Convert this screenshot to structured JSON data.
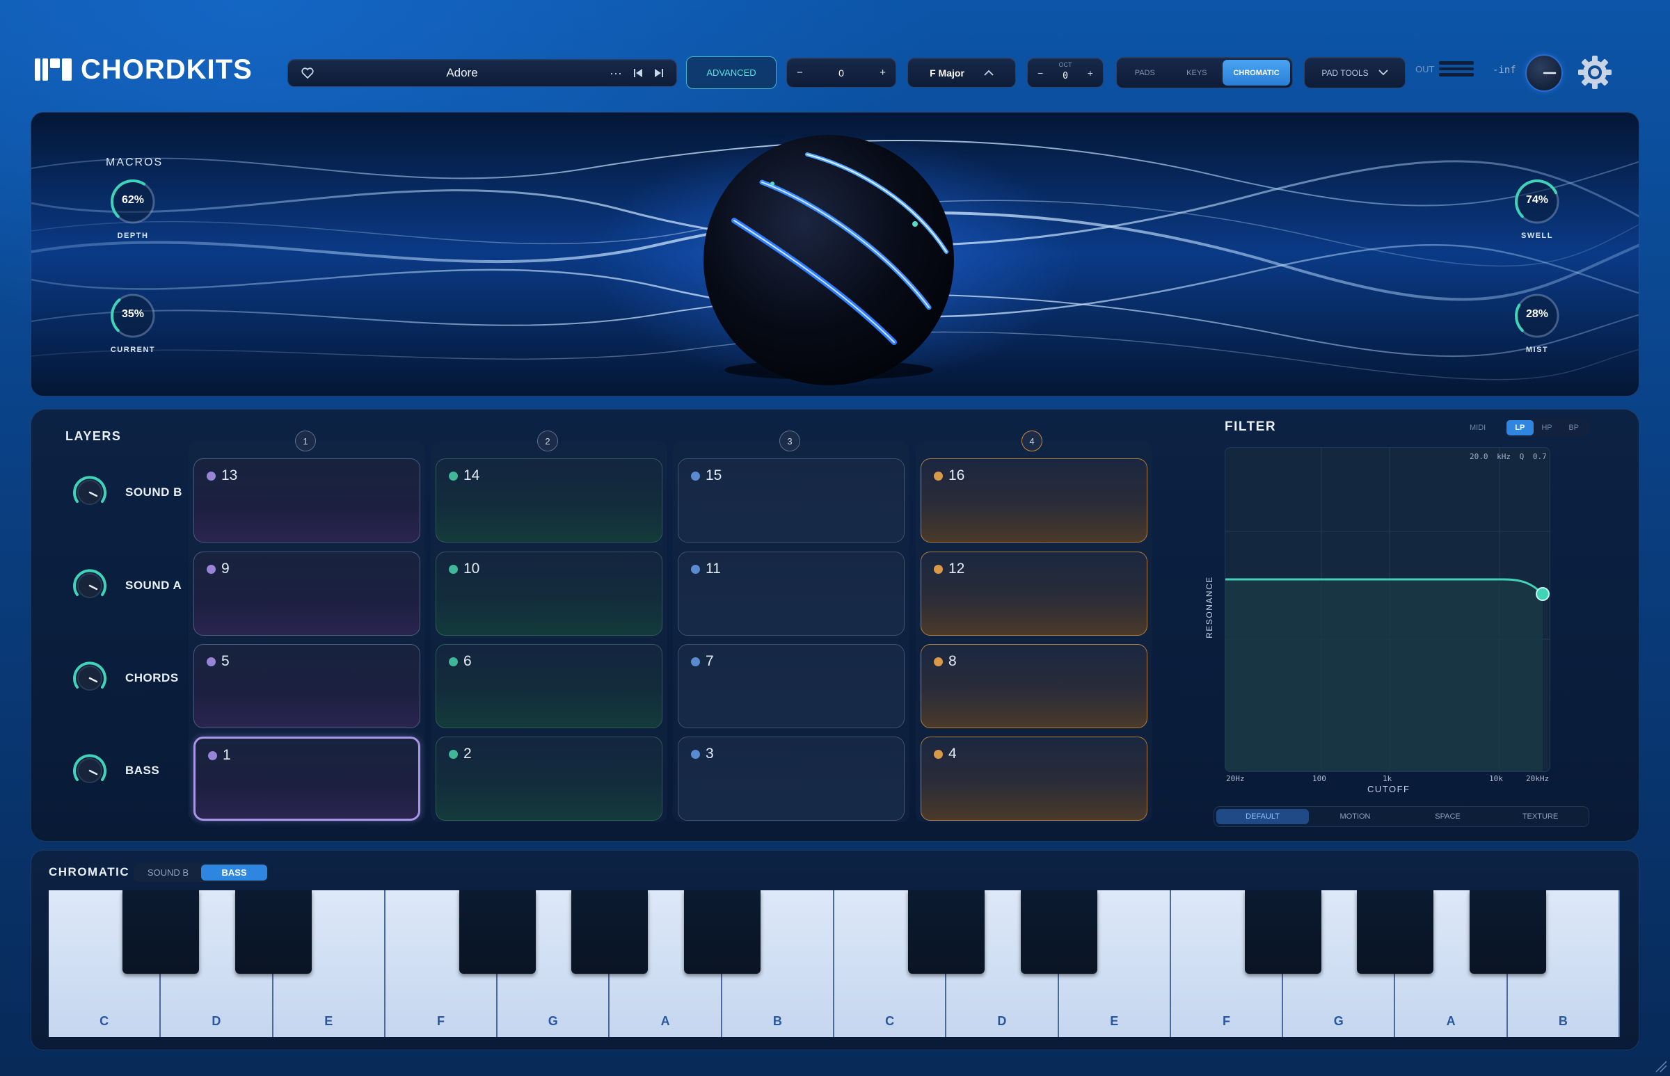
{
  "app": {
    "name": "CHORDKITS"
  },
  "header": {
    "preset_name": "Adore",
    "advanced_label": "ADVANCED",
    "transpose_value": "0",
    "transpose_minus": "−",
    "transpose_plus": "+",
    "key_label": "F Major",
    "oct_label": "OCT",
    "oct_value": "0",
    "modes": [
      {
        "label": "PADS"
      },
      {
        "label": "KEYS"
      },
      {
        "label": "CHROMATIC"
      }
    ],
    "active_mode": "CHROMATIC",
    "pad_tools_label": "PAD TOOLS",
    "out_label": "OUT",
    "out_level": "-inf"
  },
  "macros": {
    "title": "MACROS",
    "items": [
      {
        "name": "DEPTH",
        "value": "62%",
        "level": 0.62
      },
      {
        "name": "CURRENT",
        "value": "35%",
        "level": 0.35
      },
      {
        "name": "SWELL",
        "value": "74%",
        "level": 0.74
      },
      {
        "name": "MIST",
        "value": "28%",
        "level": 0.28
      }
    ]
  },
  "layers": {
    "title": "LAYERS",
    "rows": [
      {
        "label": "SOUND B",
        "pads": [
          "13",
          "14",
          "15",
          "16"
        ]
      },
      {
        "label": "SOUND A",
        "pads": [
          "9",
          "10",
          "11",
          "12"
        ]
      },
      {
        "label": "CHORDS",
        "pads": [
          "5",
          "6",
          "7",
          "8"
        ]
      },
      {
        "label": "BASS",
        "pads": [
          "1",
          "2",
          "3",
          "4"
        ]
      }
    ],
    "columns": [
      "1",
      "2",
      "3",
      "4"
    ],
    "selected_pad": "1"
  },
  "filter": {
    "title": "FILTER",
    "midi_label": "MIDI",
    "types": [
      "LP",
      "HP",
      "BP"
    ],
    "active_type": "LP",
    "freq_readout": "20.0 kHz",
    "q_readout": "Q 0.7",
    "y_label": "RESONANCE",
    "x_label": "CUTOFF",
    "x_ticks": [
      "20Hz",
      "100",
      "1k",
      "10k",
      "20kHz"
    ],
    "tabs": [
      "DEFAULT",
      "MOTION",
      "SPACE",
      "TEXTURE"
    ],
    "active_tab": "DEFAULT"
  },
  "chromatic": {
    "title": "CHROMATIC",
    "tabs": [
      "SOUND B",
      "BASS"
    ],
    "active_tab": "BASS",
    "white_keys": [
      "C",
      "D",
      "E",
      "F",
      "G",
      "A",
      "B",
      "C",
      "D",
      "E",
      "F",
      "G",
      "A",
      "B"
    ]
  },
  "colors": {
    "accent": "#2f86e0",
    "teal": "#3fd3b8",
    "purple": "#9a84d8",
    "green": "#3fb89a",
    "blue": "#5a8ad0",
    "orange": "#d89a48"
  }
}
